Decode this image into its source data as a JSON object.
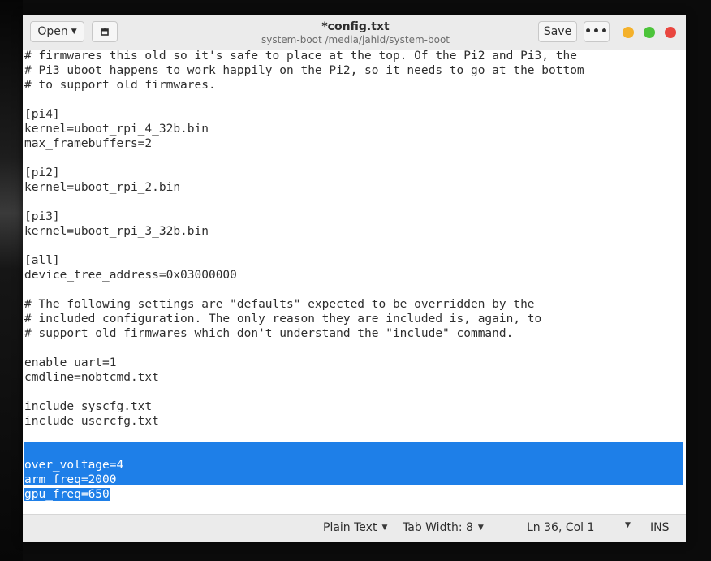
{
  "window": {
    "title": "*config.txt",
    "subtitle": "system-boot /media/jahid/system-boot"
  },
  "header": {
    "open_label": "Open",
    "save_label": "Save",
    "menu_label": "•••"
  },
  "editor": {
    "lines": [
      {
        "text": "# firmwares this old so it's safe to place at the top. Of the Pi2 and Pi3, the",
        "selected": false
      },
      {
        "text": "# Pi3 uboot happens to work happily on the Pi2, so it needs to go at the bottom",
        "selected": false
      },
      {
        "text": "# to support old firmwares.",
        "selected": false
      },
      {
        "text": "",
        "selected": false
      },
      {
        "text": "[pi4]",
        "selected": false
      },
      {
        "text": "kernel=uboot_rpi_4_32b.bin",
        "selected": false
      },
      {
        "text": "max_framebuffers=2",
        "selected": false
      },
      {
        "text": "",
        "selected": false
      },
      {
        "text": "[pi2]",
        "selected": false
      },
      {
        "text": "kernel=uboot_rpi_2.bin",
        "selected": false
      },
      {
        "text": "",
        "selected": false
      },
      {
        "text": "[pi3]",
        "selected": false
      },
      {
        "text": "kernel=uboot_rpi_3_32b.bin",
        "selected": false
      },
      {
        "text": "",
        "selected": false
      },
      {
        "text": "[all]",
        "selected": false
      },
      {
        "text": "device_tree_address=0x03000000",
        "selected": false
      },
      {
        "text": "",
        "selected": false
      },
      {
        "text": "# The following settings are \"defaults\" expected to be overridden by the",
        "selected": false
      },
      {
        "text": "# included configuration. The only reason they are included is, again, to",
        "selected": false
      },
      {
        "text": "# support old firmwares which don't understand the \"include\" command.",
        "selected": false
      },
      {
        "text": "",
        "selected": false
      },
      {
        "text": "enable_uart=1",
        "selected": false
      },
      {
        "text": "cmdline=nobtcmd.txt",
        "selected": false
      },
      {
        "text": "",
        "selected": false
      },
      {
        "text": "include syscfg.txt",
        "selected": false
      },
      {
        "text": "include usercfg.txt",
        "selected": false
      },
      {
        "text": "",
        "selected": false
      },
      {
        "text": "",
        "selected": true
      },
      {
        "text": "over_voltage=4",
        "selected": true
      },
      {
        "text": "arm_freq=2000",
        "selected": true
      },
      {
        "text": "gpu_freq=650",
        "selected": "partial"
      }
    ]
  },
  "statusbar": {
    "language": "Plain Text",
    "tab_width": "Tab Width: 8",
    "cursor_position": "Ln 36, Col 1",
    "insert_mode": "INS"
  },
  "colors": {
    "selection": "#1e7fe8",
    "minimize": "#f4b12b",
    "maximize": "#4cc43a",
    "close": "#e9463f"
  }
}
